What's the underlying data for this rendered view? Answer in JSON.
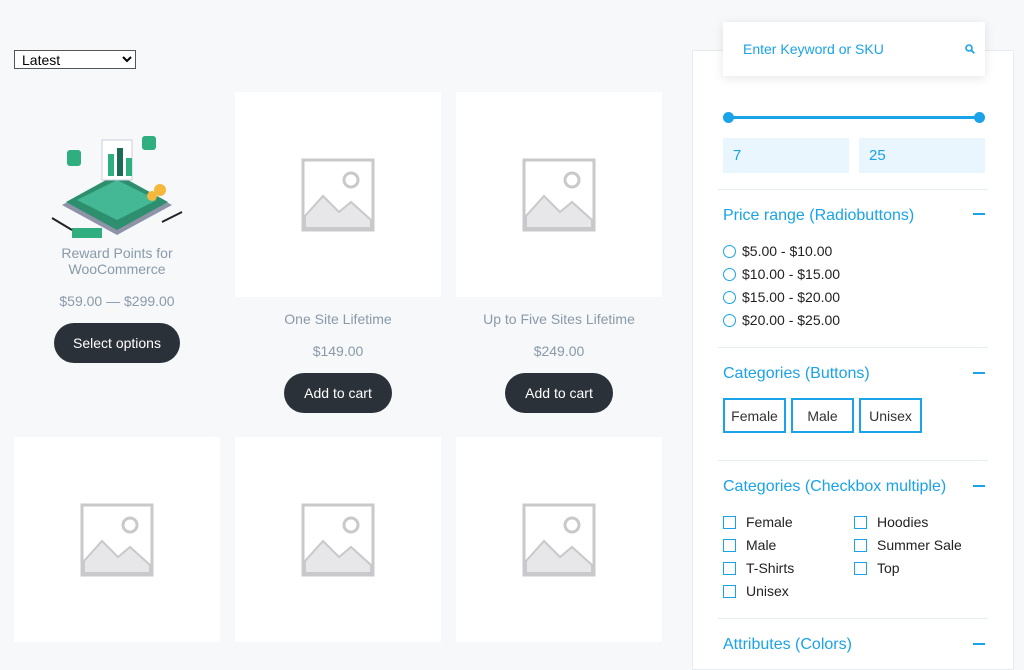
{
  "sort": {
    "selected": "Latest"
  },
  "products": [
    {
      "title": "Reward Points for WooCommerce",
      "price": "$59.00 — $299.00",
      "button": "Select options"
    },
    {
      "title": "One Site Lifetime",
      "price": "$149.00",
      "button": "Add to cart"
    },
    {
      "title": "Up to Five Sites Lifetime",
      "price": "$249.00",
      "button": "Add to cart"
    }
  ],
  "sidebar": {
    "search": {
      "placeholder": "Enter Keyword or SKU",
      "icon": "search-icon"
    },
    "slider": {
      "min": "7",
      "max": "25"
    },
    "price_range": {
      "title": "Price range (Radiobuttons)",
      "options": [
        "$5.00 - $10.00",
        "$10.00 - $15.00",
        "$15.00 - $20.00",
        "$20.00 - $25.00"
      ]
    },
    "categories_buttons": {
      "title": "Categories (Buttons)",
      "options": [
        "Female",
        "Male",
        "Unisex"
      ]
    },
    "categories_checkbox": {
      "title": "Categories (Checkbox multiple)",
      "options": [
        "Female",
        "Male",
        "T-Shirts",
        "Unisex",
        "Hoodies",
        "Summer Sale",
        "Top"
      ]
    },
    "attributes": {
      "title": "Attributes (Colors)"
    }
  },
  "colors": {
    "accent": "#1aa3e8",
    "button_dark": "#2b3138",
    "muted_text": "#8a9aa8"
  }
}
